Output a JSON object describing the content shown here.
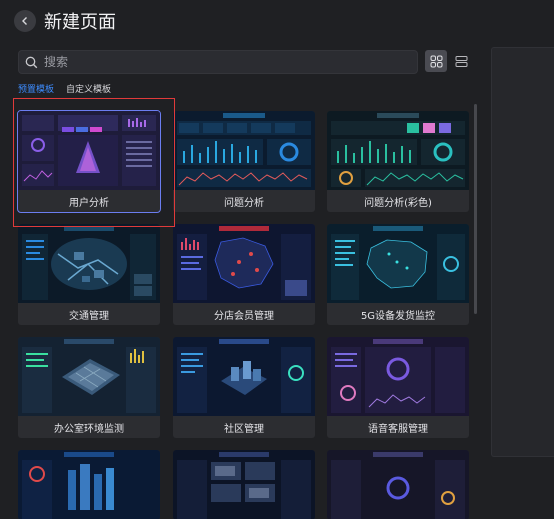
{
  "header": {
    "title": "新建页面",
    "back_icon": "chevron-left-icon"
  },
  "search": {
    "placeholder": "搜索"
  },
  "view_toggle": {
    "grid_icon": "grid-view-icon",
    "list_icon": "list-view-icon",
    "active": "grid"
  },
  "tabs": [
    {
      "label": "预置模板",
      "active": true
    },
    {
      "label": "自定义模板",
      "active": false
    }
  ],
  "colors": {
    "accent": "#3d8cff",
    "selection_outline": "#e03a3a",
    "background": "#1f2023",
    "card": "#2c2d31"
  },
  "templates": [
    {
      "label": "用户分析",
      "selected": true,
      "theme": "purple",
      "thumb_title": "TOTAL VALUE",
      "thumb_number": "124,232"
    },
    {
      "label": "问题分析",
      "selected": false,
      "theme": "cyan"
    },
    {
      "label": "问题分析(彩色)",
      "selected": false,
      "theme": "color"
    },
    {
      "label": "交通管理",
      "selected": false,
      "theme": "city"
    },
    {
      "label": "分店会员管理",
      "selected": false,
      "theme": "map-red"
    },
    {
      "label": "5G设备发货监控",
      "selected": false,
      "theme": "map-blue"
    },
    {
      "label": "办公室环境监测",
      "selected": false,
      "theme": "office"
    },
    {
      "label": "社区管理",
      "selected": false,
      "theme": "community"
    },
    {
      "label": "语音客服管理",
      "selected": false,
      "theme": "purple-dark"
    },
    {
      "label": "",
      "selected": false,
      "theme": "blue-city"
    },
    {
      "label": "",
      "selected": false,
      "theme": "video"
    },
    {
      "label": "",
      "selected": false,
      "theme": "dark-purple"
    }
  ]
}
